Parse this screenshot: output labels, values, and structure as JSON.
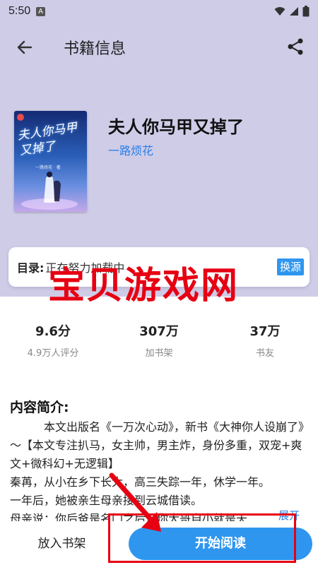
{
  "status_bar": {
    "time": "5:50",
    "notif_letter": "A"
  },
  "app_bar": {
    "title": "书籍信息",
    "back_icon": "arrow-left-icon",
    "share_icon": "share-icon"
  },
  "book": {
    "cover_title": "夫人你马甲又掉了",
    "cover_author_small": "一路烦花 · 著",
    "name": "夫人你马甲又掉了",
    "author": "一路烦花"
  },
  "toc": {
    "label": "目录:",
    "value": "正在努力加载中",
    "switch_label": "换源"
  },
  "watermark": "宝贝游戏网",
  "stats": [
    {
      "value": "9.6分",
      "label": "4.9万人评分"
    },
    {
      "value": "307万",
      "label": "加书架"
    },
    {
      "value": "37万",
      "label": "书友"
    }
  ],
  "intro": {
    "heading": "内容简介:",
    "lines": [
      "本文出版名《一万次心动》，新书《大神你人设崩了》～【本文专注扒马，女主帅，男主炸，身份多重，双宠+爽文+微科幻+无逻辑】",
      "秦苒，从小在乡下长大，高三失踪一年，休学一年。",
      "一年后，她被亲生母亲接到云城借读。",
      "母亲说：你后爸是名门之后，你大哥自小就是天..."
    ],
    "expand_label": "展开"
  },
  "bottom_bar": {
    "shelf_label": "放入书架",
    "read_label": "开始阅读"
  },
  "colors": {
    "header_bg": "#cfcce8",
    "accent": "#2f96ef",
    "author_link": "#2a7ee6",
    "watermark": "#e60012"
  }
}
